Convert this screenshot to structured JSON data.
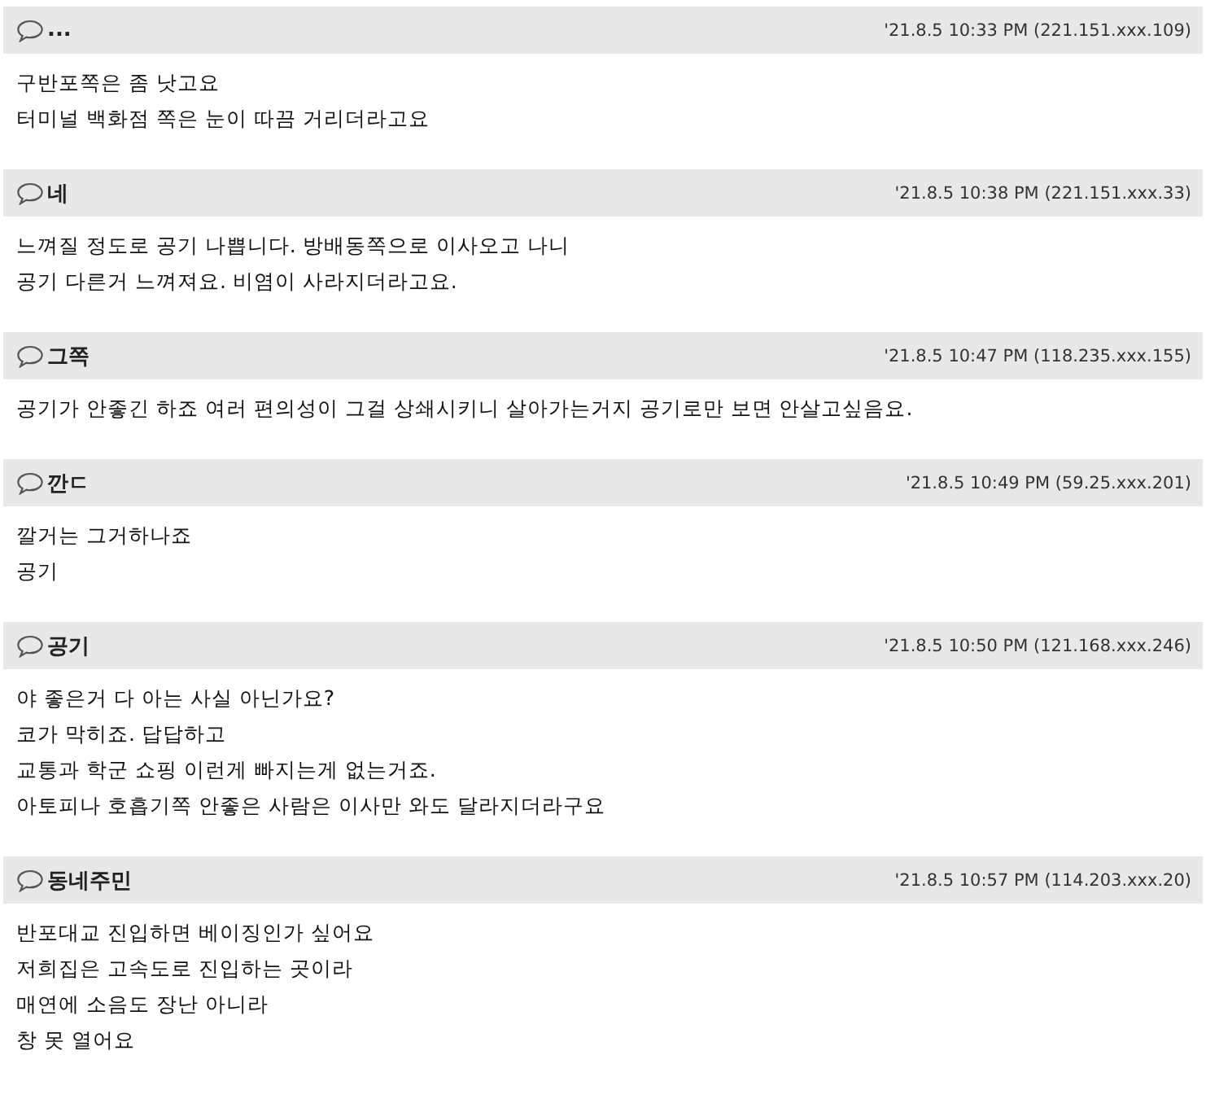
{
  "comments": [
    {
      "author": "...",
      "meta": "'21.8.5 10:33 PM (221.151.xxx.109)",
      "lines": [
        "구반포쪽은 좀 낫고요",
        "터미널 백화점 쪽은 눈이 따끔 거리더라고요"
      ]
    },
    {
      "author": "네",
      "meta": "'21.8.5 10:38 PM (221.151.xxx.33)",
      "lines": [
        "느껴질 정도로 공기 나쁩니다. 방배동쪽으로 이사오고 나니",
        "공기 다른거 느껴져요. 비염이 사라지더라고요."
      ]
    },
    {
      "author": "그쪽",
      "meta": "'21.8.5 10:47 PM (118.235.xxx.155)",
      "lines": [
        "공기가 안좋긴 하죠 여러 편의성이 그걸 상쇄시키니 살아가는거지 공기로만 보면 안살고싶음요."
      ]
    },
    {
      "author": "깐ㄷ",
      "meta": "'21.8.5 10:49 PM (59.25.xxx.201)",
      "lines": [
        "깔거는 그거하나죠",
        "공기"
      ]
    },
    {
      "author": "공기",
      "meta": "'21.8.5 10:50 PM (121.168.xxx.246)",
      "lines": [
        "야 좋은거 다 아는 사실 아닌가요?",
        "코가 막히죠. 답답하고",
        "교통과 학군 쇼핑 이런게 빠지는게 없는거죠.",
        "아토피나 호흡기쪽 안좋은 사람은 이사만 와도 달라지더라구요"
      ]
    },
    {
      "author": "동네주민",
      "meta": "'21.8.5 10:57 PM (114.203.xxx.20)",
      "lines": [
        "반포대교 진입하면 베이징인가 싶어요",
        "저희집은 고속도로 진입하는 곳이라",
        "매연에 소음도 장난 아니라",
        "창 못 열어요"
      ]
    }
  ]
}
